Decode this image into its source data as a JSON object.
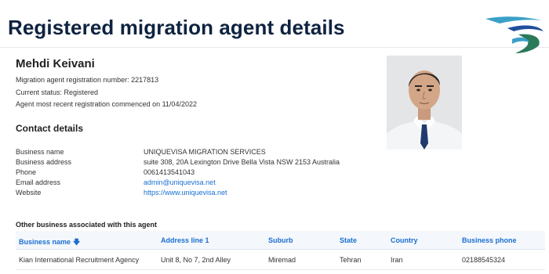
{
  "page": {
    "title": "Registered migration agent details"
  },
  "logo": {
    "icon": "swoosh-logo-icon",
    "colors": [
      "#2a7a5a",
      "#3aa0c8",
      "#1f4f9e"
    ]
  },
  "agent": {
    "name": "Mehdi Keivani",
    "registration_line": "Migration agent registration number:  2217813",
    "status_line": "Current status:  Registered",
    "commenced_line": "Agent most recent registration commenced on 11/04/2022",
    "photo_icon": "agent-photo"
  },
  "contact": {
    "heading": "Contact details",
    "rows": [
      {
        "label": "Business name",
        "value": "UNIQUEVISA MIGRATION SERVICES"
      },
      {
        "label": "Business address",
        "value": "suite 308, 20A Lexington Drive Bella Vista NSW 2153 Australia"
      },
      {
        "label": "Phone",
        "value": "0061413541043"
      },
      {
        "label": "Email address",
        "value": "admin@uniquevisa.net"
      },
      {
        "label": "Website",
        "value": "https://www.uniquevisa.net"
      }
    ]
  },
  "other_business": {
    "heading": "Other business associated with this agent",
    "columns": [
      "Business name",
      "Address line 1",
      "Suburb",
      "State",
      "Country",
      "Business phone"
    ],
    "sort_icon": "arrow-down-icon",
    "rows": [
      [
        "Kian International Recruitment Agency",
        "Unit 8, No 7, 2nd Alley",
        "Miremad",
        "Tehran",
        "Iran",
        "02188545324"
      ]
    ]
  },
  "colors": {
    "title": "#0f2340",
    "link": "#1a6fd0",
    "header_bg": "#f4f7fb"
  }
}
